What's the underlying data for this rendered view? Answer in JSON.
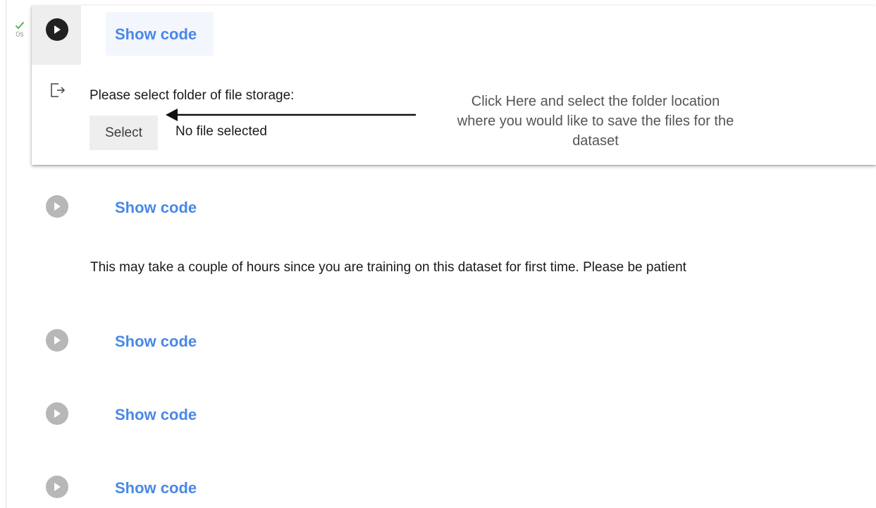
{
  "cell_status": {
    "check": "✓",
    "exec_time": "0s",
    "success_color": "#4caf50"
  },
  "cells": [
    {
      "show_code_label": "Show code",
      "run_state": "active"
    },
    {
      "show_code_label": "Show code",
      "run_state": "idle"
    },
    {
      "show_code_label": "Show code",
      "run_state": "idle"
    },
    {
      "show_code_label": "Show code",
      "run_state": "idle"
    },
    {
      "show_code_label": "Show code",
      "run_state": "idle"
    }
  ],
  "output": {
    "icon": "output-redirect-icon",
    "prompt": "Please select folder of file storage:",
    "select_button": "Select",
    "file_status": "No file selected"
  },
  "annotation": {
    "text": "Click Here and select the folder location where you would like to save the files for the dataset"
  },
  "text_cell": {
    "text": "This may take a couple of hours since you are training on this dataset for first time. Please be patient"
  },
  "colors": {
    "link": "#4a88e6",
    "run_active": "#212121",
    "run_idle": "#b7b7b7",
    "gutter": "#eeeeee"
  }
}
